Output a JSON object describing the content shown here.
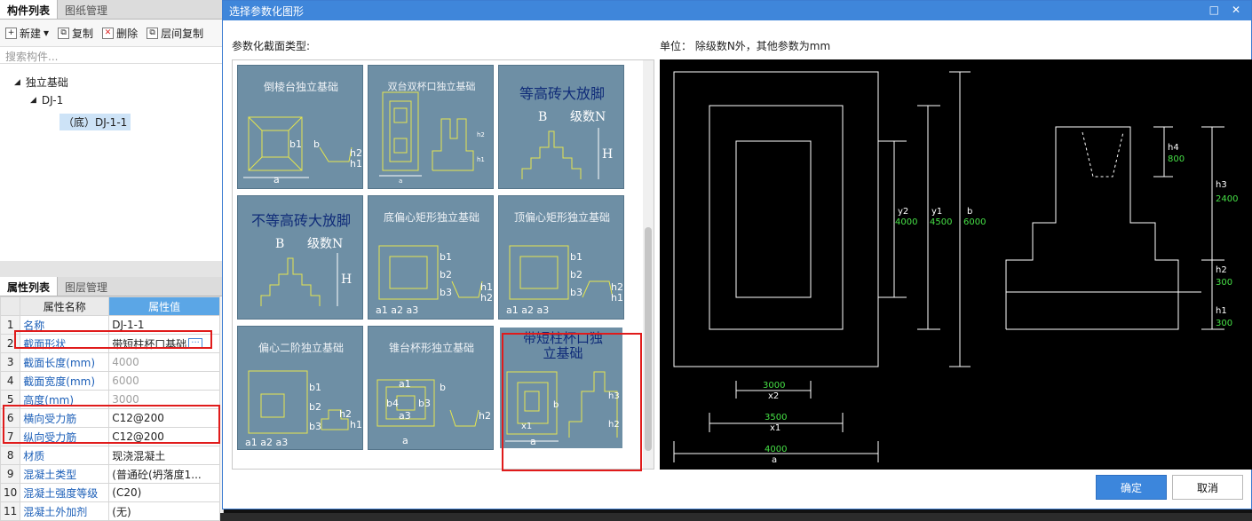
{
  "left_panel": {
    "tabs": [
      "构件列表",
      "图纸管理"
    ],
    "toolbar": {
      "new": "新建",
      "copy": "复制",
      "delete": "删除",
      "floor_copy": "层间复制"
    },
    "search_placeholder": "搜索构件...",
    "tree": {
      "root": "独立基础",
      "child": "DJ-1",
      "leaf": "（底）DJ-1-1"
    },
    "prop_tabs": [
      "属性列表",
      "图层管理"
    ],
    "prop_headers": {
      "name": "属性名称",
      "value": "属性值"
    },
    "props": [
      {
        "n": "1",
        "name": "名称",
        "value": "DJ-1-1"
      },
      {
        "n": "2",
        "name": "截面形状",
        "value": "带短柱杯口基础"
      },
      {
        "n": "3",
        "name": "截面长度(mm)",
        "value": "4000"
      },
      {
        "n": "4",
        "name": "截面宽度(mm)",
        "value": "6000"
      },
      {
        "n": "5",
        "name": "高度(mm)",
        "value": "3000"
      },
      {
        "n": "6",
        "name": "横向受力筋",
        "value": "C12@200"
      },
      {
        "n": "7",
        "name": "纵向受力筋",
        "value": "C12@200"
      },
      {
        "n": "8",
        "name": "材质",
        "value": "现浇混凝土"
      },
      {
        "n": "9",
        "name": "混凝土类型",
        "value": "(普通砼(坍落度1..."
      },
      {
        "n": "10",
        "name": "混凝土强度等级",
        "value": "(C20)"
      },
      {
        "n": "11",
        "name": "混凝土外加剂",
        "value": "(无)"
      }
    ]
  },
  "dialog": {
    "title": "选择参数化图形",
    "section_label": "参数化截面类型:",
    "unit_label": "单位：  除级数N外，其他参数为mm",
    "ok": "确定",
    "cancel": "取消",
    "shapes": [
      "倒棱台独立基础",
      "双台双杯口独立基础",
      "等高砖大放脚",
      "不等高砖大放脚",
      "底偏心矩形独立基础",
      "顶偏心矩形独立基础",
      "偏心二阶独立基础",
      "锥台杯形独立基础",
      "带短柱杯口独立基础"
    ],
    "preview": {
      "x2": "3000",
      "x1": "3500",
      "a": "4000",
      "y2": "4000",
      "y1": "4500",
      "b": "6000",
      "h4": "800",
      "h3": "2400",
      "h2": "300",
      "h1": "300"
    }
  }
}
